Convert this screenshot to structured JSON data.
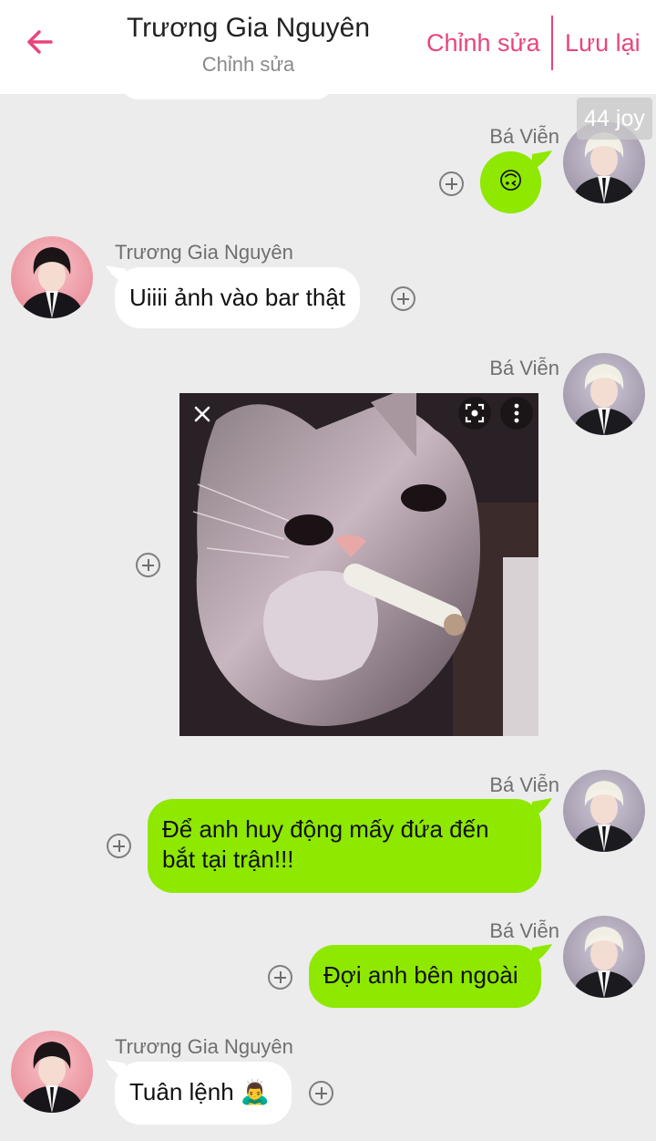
{
  "header": {
    "title": "Trương Gia Nguyên",
    "subtitle": "Chỉnh sửa",
    "edit_label": "Chỉnh sửa",
    "save_label": "Lưu lại"
  },
  "watermark": "44 joy",
  "colors": {
    "accent": "#e8457a",
    "sent_bubble": "#8ee800",
    "received_bubble": "#ffffff",
    "background": "#ececec"
  },
  "messages": [
    {
      "sender": "Bá Viễn",
      "side": "right",
      "text": "🙃"
    },
    {
      "sender": "Trương Gia Nguyên",
      "side": "left",
      "text": "Uiiii ảnh vào bar thật"
    },
    {
      "sender": "Bá Viễn",
      "side": "right",
      "image": "cat-smoking-photo"
    },
    {
      "sender": "Bá Viễn",
      "side": "right",
      "text": "Để anh huy động mấy đứa đến bắt tại trận!!!"
    },
    {
      "sender": "Bá Viễn",
      "side": "right",
      "text": "Đợi anh bên ngoài"
    },
    {
      "sender": "Trương Gia Nguyên",
      "side": "left",
      "text": "Tuân lệnh 🙇‍♂️"
    }
  ]
}
